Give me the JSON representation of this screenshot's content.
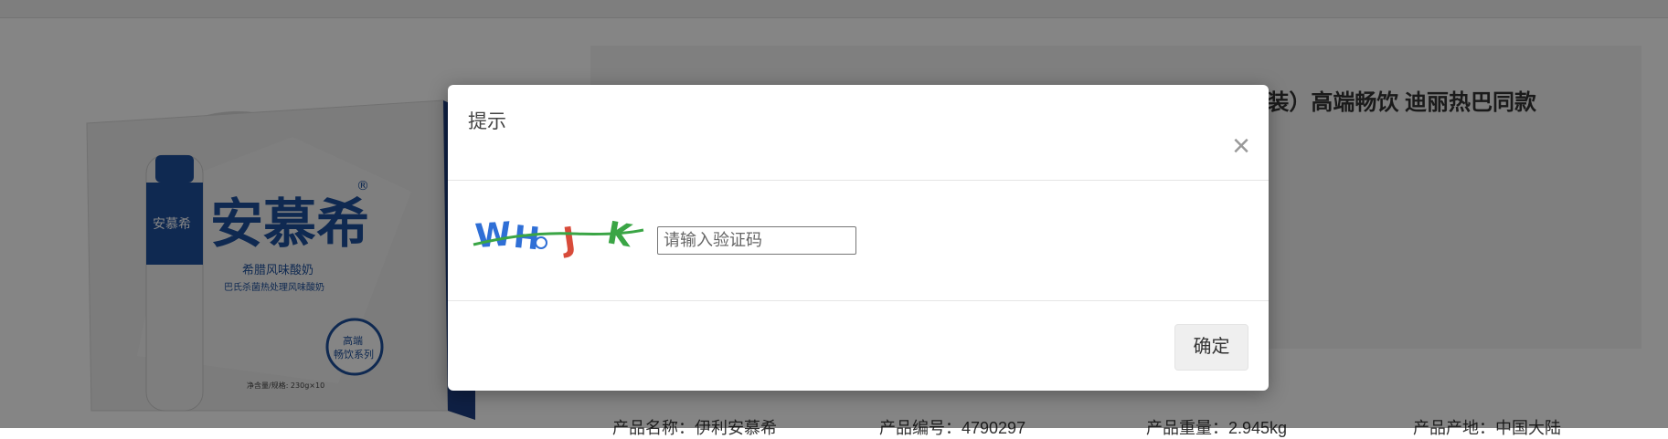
{
  "page": {
    "product_title": "装）高端畅饮 迪丽热巴同款",
    "specs": [
      "产品名称：伊利安慕希",
      "产品编号：4790297",
      "产品重量：2.945kg",
      "产品产地：中国大陆"
    ]
  },
  "product_image": {
    "brand": "安慕希",
    "registered_mark": "®",
    "subtitle": "希腊风味酸奶",
    "subline": "巴氏杀菌热处理风味酸奶",
    "badge_line1": "高端",
    "badge_line2": "畅饮系列",
    "net_content": "净含量/规格: 230g×10"
  },
  "dialog": {
    "title": "提示",
    "close_symbol": "×",
    "captcha_text": [
      "W",
      "H",
      "J",
      "K"
    ],
    "captcha_colors": [
      "#2f6fd6",
      "#2f6fd6",
      "#d84b3a",
      "#3aa545"
    ],
    "input_placeholder": "请输入验证码",
    "input_value": "",
    "confirm_label": "确定"
  }
}
